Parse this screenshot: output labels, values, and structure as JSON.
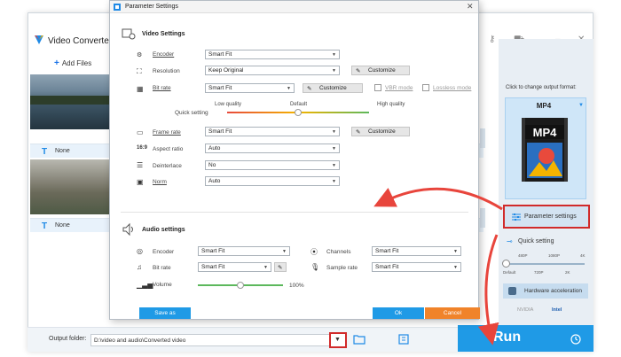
{
  "app": {
    "title": "Video Converter",
    "add_files": "Add Files",
    "subtitle_none": "None"
  },
  "right_panel": {
    "format_prompt": "Click to change output format:",
    "format_name": "MP4",
    "format_badge": "MP4",
    "parameter_settings": "Parameter settings",
    "quick_setting": "Quick setting",
    "quick_ticks_top": [
      "480P",
      "1080P",
      "4K"
    ],
    "quick_ticks_bottom": [
      "Default",
      "720P",
      "2K"
    ],
    "hardware_acceleration": "Hardware acceleration",
    "gpu_nvidia": "NVIDIA",
    "gpu_intel": "Intel"
  },
  "bottom": {
    "output_folder_label": "Output folder:",
    "output_folder_value": "D:\\video and audio\\Converted video",
    "run_label": "Run"
  },
  "dialog": {
    "title": "Parameter Settings",
    "video_section": "Video Settings",
    "audio_section": "Audio settings",
    "video_rows": {
      "encoder": {
        "label": "Encoder",
        "value": "Smart Fit"
      },
      "resolution": {
        "label": "Resolution",
        "value": "Keep Original",
        "button": "Customize"
      },
      "bitrate": {
        "label": "Bit rate",
        "value": "Smart Fit",
        "button": "Customize",
        "vbr": "VBR mode",
        "lossless": "Lossless mode"
      },
      "quick_setting": "Quick setting",
      "quality_low": "Low quality",
      "quality_default": "Default",
      "quality_high": "High quality",
      "quality_level": 0.5,
      "framerate": {
        "label": "Frame rate",
        "value": "Smart Fit",
        "button": "Customize"
      },
      "aspect": {
        "label": "Aspect ratio",
        "value": "Auto"
      },
      "deinterlace": {
        "label": "Deinterlace",
        "value": "No"
      },
      "norm": {
        "label": "Norm",
        "value": "Auto"
      }
    },
    "audio_rows": {
      "encoder": {
        "label": "Encoder",
        "value": "Smart Fit"
      },
      "bitrate": {
        "label": "Bit rate",
        "value": "Smart Fit"
      },
      "volume": {
        "label": "Volume",
        "value": "100%",
        "level": 1.0
      },
      "channels": {
        "label": "Channels",
        "value": "Smart Fit"
      },
      "samplerate": {
        "label": "Sample rate",
        "value": "Smart Fit"
      }
    },
    "save_as": "Save as",
    "ok": "Ok",
    "cancel": "Cancel"
  },
  "colors": {
    "accent": "#1f9ae6",
    "highlight_red": "#d12a2a",
    "cancel_orange": "#f0832a"
  }
}
